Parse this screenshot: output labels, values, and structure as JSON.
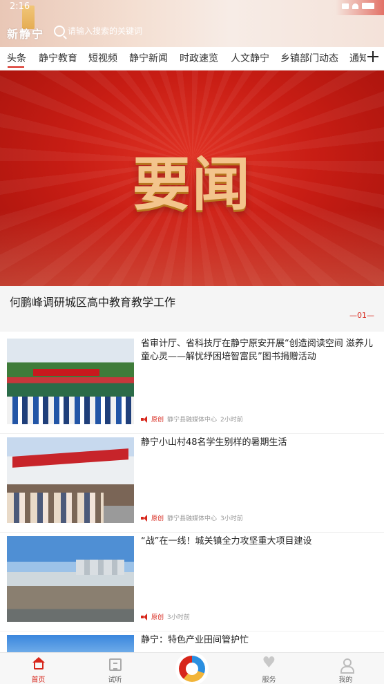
{
  "status_bar": {
    "time": "2:16"
  },
  "header": {
    "brand": "新静宁",
    "search_placeholder": "请输入搜索的关键词"
  },
  "tabs": [
    "头条",
    "静宁教育",
    "短视频",
    "静宁新闻",
    "时政速览",
    "人文静宁",
    "乡镇部门动态",
    "通知"
  ],
  "banner": {
    "headline": "要闻"
  },
  "featured": {
    "title": "何鹏峰调研城区高中教育教学工作",
    "counter": "—01—"
  },
  "articles": [
    {
      "title": "省审计厅、省科技厅在静宁原安开展“创造阅读空间 滋养儿童心灵——解忧纾困培智富民”图书捐赠活动",
      "tag": "原创",
      "source": "静宁县融媒体中心",
      "time": "2小时前"
    },
    {
      "title": "静宁小山村48名学生别样的暑期生活",
      "tag": "原创",
      "source": "静宁县融媒体中心",
      "time": "3小时前"
    },
    {
      "title": "“战”在一线！城关镇全力攻坚重大项目建设",
      "tag": "原创",
      "source": "",
      "time": "3小时前"
    },
    {
      "title": "静宁：特色产业田间管护忙",
      "tag": "",
      "source": "",
      "time": ""
    }
  ],
  "bottom_nav": [
    {
      "label": "首页",
      "icon": "home-icon",
      "active": true
    },
    {
      "label": "试听",
      "icon": "media-icon",
      "active": false
    },
    {
      "label": "",
      "icon": "app-logo-icon",
      "active": false
    },
    {
      "label": "服务",
      "icon": "service-icon",
      "active": false
    },
    {
      "label": "我的",
      "icon": "user-icon",
      "active": false
    }
  ],
  "colors": {
    "accent": "#d7261b",
    "banner": "#c81d14",
    "gold": "#f3c48c"
  }
}
